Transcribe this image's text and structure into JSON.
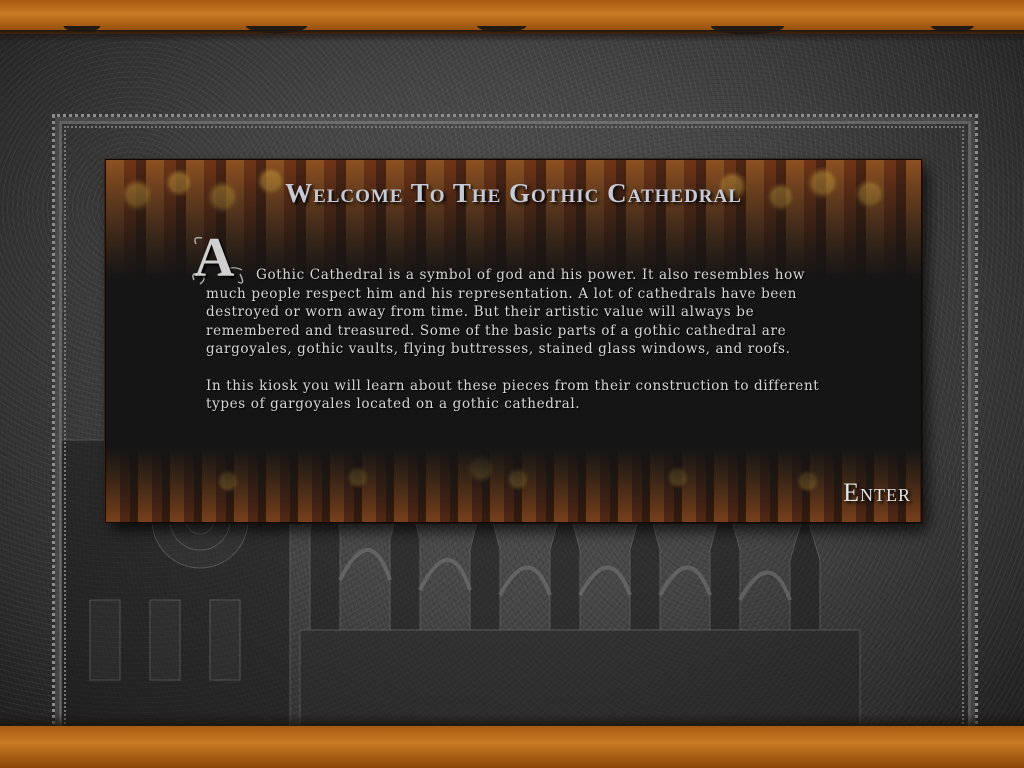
{
  "header": {
    "title": "Welcome To The Gothic Cathedral"
  },
  "intro": {
    "drop_cap": "A",
    "paragraph1": "Gothic Cathedral is a symbol of god and his power. It also resembles how much people respect him and his representation. A lot of cathedrals have been destroyed or worn away from time. But their artistic value will always be remembered and treasured. Some of the basic parts of a gothic cathedral are gargoyales, gothic vaults, flying buttresses, stained glass windows, and roofs.",
    "paragraph2": "In this kiosk you will learn about these pieces from their construction to different types of gargoyales located on a gothic cathedral."
  },
  "navigation": {
    "enter_label": "Enter"
  },
  "colors": {
    "accent_orange": "#c97a24",
    "title_color": "#c6c9d6",
    "panel_bg": "#151515",
    "stone_gray": "#474747"
  }
}
